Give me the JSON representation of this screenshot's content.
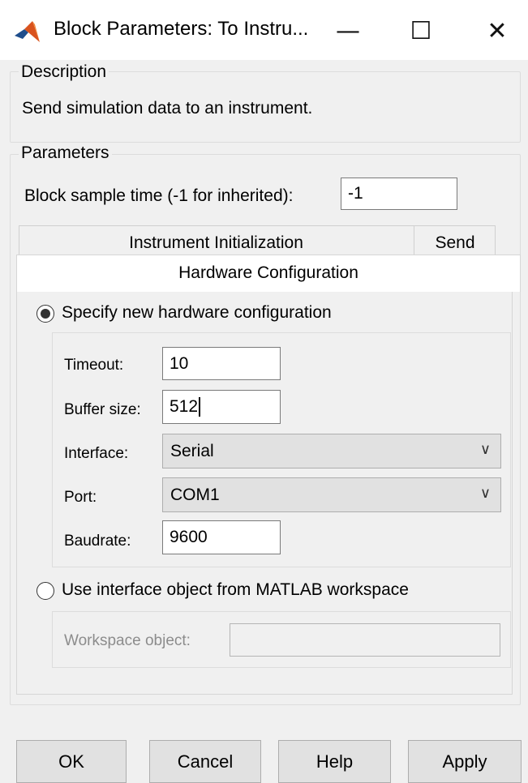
{
  "window": {
    "title": "Block Parameters: To Instru...",
    "minimize_glyph": "—",
    "maximize_glyph": "☐",
    "close_glyph": "✕",
    "icon": "matlab-icon"
  },
  "description": {
    "legend": "Description",
    "text": "Send simulation data to an instrument."
  },
  "parameters": {
    "legend": "Parameters",
    "sample_time_label": "Block sample time (-1 for inherited):",
    "sample_time_value": "-1"
  },
  "tabs": {
    "items": [
      "Instrument Initialization",
      "Send"
    ],
    "active": "Hardware Configuration"
  },
  "hardware": {
    "new_config_label": "Specify new hardware configuration",
    "new_config_selected": true,
    "timeout_label": "Timeout:",
    "timeout_value": "10",
    "buffer_label": "Buffer size:",
    "buffer_value": "512",
    "interface_label": "Interface:",
    "interface_value": "Serial",
    "port_label": "Port:",
    "port_value": "COM1",
    "baud_label": "Baudrate:",
    "baud_value": "9600",
    "dropdown_glyph": "∨",
    "workspace_option_label": "Use interface object from MATLAB workspace",
    "workspace_option_selected": false,
    "workspace_object_label": "Workspace object:",
    "workspace_object_value": ""
  },
  "buttons": {
    "ok": "OK",
    "cancel": "Cancel",
    "help": "Help",
    "apply": "Apply"
  },
  "colors": {
    "matlab_orange": "#d9531e",
    "matlab_blue": "#1f4e8c",
    "dialog_bg": "#f0f0f0",
    "button_bg": "#e1e1e1"
  }
}
